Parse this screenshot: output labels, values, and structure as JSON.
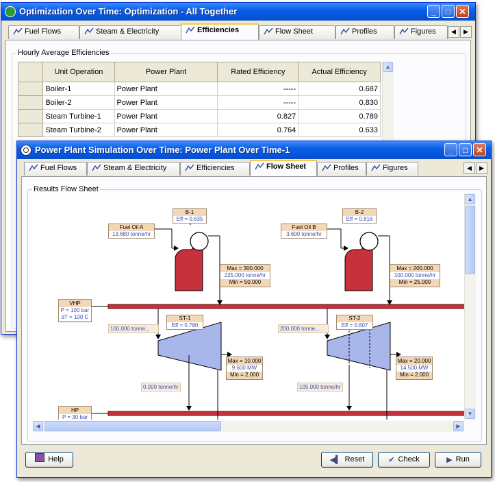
{
  "back_window": {
    "title": "Optimization Over Time: Optimization - All Together",
    "tabs": [
      {
        "label": "Fuel Flows",
        "active": false
      },
      {
        "label": "Steam & Electricity",
        "active": false
      },
      {
        "label": "Efficiencies",
        "active": true
      },
      {
        "label": "Flow Sheet",
        "active": false
      },
      {
        "label": "Profiles",
        "active": false
      },
      {
        "label": "Figures",
        "active": false
      }
    ],
    "group_label": "Hourly Average Efficiencies",
    "table": {
      "columns": [
        "Unit Operation",
        "Power Plant",
        "Rated Efficiency",
        "Actual Efficiency"
      ],
      "rows": [
        [
          "Boiler-1",
          "Power Plant",
          "-----",
          "0.687"
        ],
        [
          "Boiler-2",
          "Power Plant",
          "-----",
          "0.830"
        ],
        [
          "Steam Turbine-1",
          "Power Plant",
          "0.827",
          "0.789"
        ],
        [
          "Steam Turbine-2",
          "Power Plant",
          "0.764",
          "0.633"
        ]
      ]
    }
  },
  "front_window": {
    "title": "Power Plant Simulation Over Time: Power Plant Over Time-1",
    "tabs": [
      {
        "label": "Fuel Flows",
        "active": false
      },
      {
        "label": "Steam & Electricity",
        "active": false
      },
      {
        "label": "Efficiencies",
        "active": false
      },
      {
        "label": "Flow Sheet",
        "active": true
      },
      {
        "label": "Profiles",
        "active": false
      },
      {
        "label": "Figures",
        "active": false
      }
    ],
    "group_label": "Results Flow Sheet",
    "buttons": {
      "help": "Help",
      "reset": "Reset",
      "check": "Check",
      "run": "Run"
    }
  },
  "flowsheet": {
    "b1": {
      "name": "B-1",
      "eff": "Eff = 0.635"
    },
    "b2": {
      "name": "B-2",
      "eff": "Eff = 0.816"
    },
    "fuel_a": {
      "name": "Fuel Oil A",
      "flow": "13.680 tonne/hr"
    },
    "fuel_b": {
      "name": "Fuel Oil B",
      "flow": "3.600 tonne/hr"
    },
    "b1_limits": {
      "max": "Max = 300.000",
      "val": "225.000 tonne/hr",
      "min": "Min = 50.000"
    },
    "b2_limits": {
      "max": "Max = 200.000",
      "val": "100.000 tonne/hr",
      "min": "Min = 25.000"
    },
    "vhp": {
      "name": "VHP",
      "p": "P = 100 bar",
      "dt": "dT = 100 C"
    },
    "hp": {
      "name": "HP",
      "p": "P = 30 bar"
    },
    "st1": {
      "name": "ST-1",
      "eff": "Eff = 0.780"
    },
    "st2": {
      "name": "ST-2",
      "eff": "Eff = 0.607"
    },
    "st1_in": "100.000  tonne...",
    "st2_in": "200.000  tonne...",
    "st1_limits": {
      "max": "Max = 10.000",
      "val": "9.600 MW",
      "min": "Min = 2.000"
    },
    "st2_limits": {
      "max": "Max = 20.000",
      "val": "14.500 MW",
      "min": "Min = 2.000"
    },
    "st1_ext": "0.000 tonne/hr",
    "st2_ext": "105.000 tonne/hr"
  },
  "colors": {
    "header_red": "#c7313c",
    "turbine_blue": "#a9b6ea",
    "label_tan": "#f3d8b8"
  }
}
